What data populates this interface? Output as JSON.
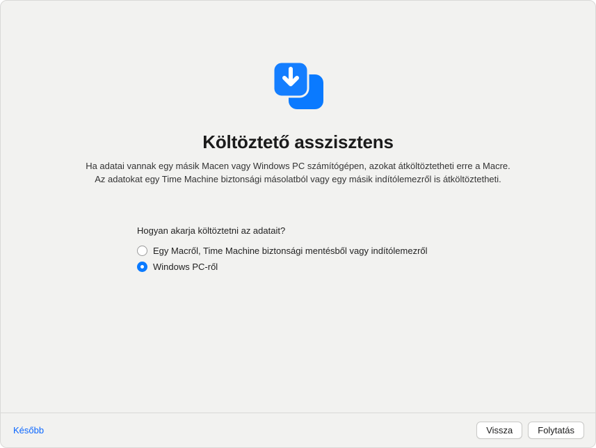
{
  "title": "Költöztető asszisztens",
  "subtitle_line1": "Ha adatai vannak egy másik Macen vagy Windows PC számítógépen, azokat átköltöztetheti erre a Macre.",
  "subtitle_line2": "Az adatokat egy Time Machine biztonsági másolatból vagy egy másik indítólemezről is átköltöztetheti.",
  "question": "Hogyan akarja költöztetni az adatait?",
  "options": [
    {
      "label": "Egy Macről, Time Machine biztonsági mentésből vagy indítólemezről",
      "selected": false
    },
    {
      "label": "Windows PC-ről",
      "selected": true
    }
  ],
  "footer": {
    "later": "Később",
    "back": "Vissza",
    "continue": "Folytatás"
  },
  "colors": {
    "accent": "#0a7aff",
    "link": "#0a66ff"
  }
}
